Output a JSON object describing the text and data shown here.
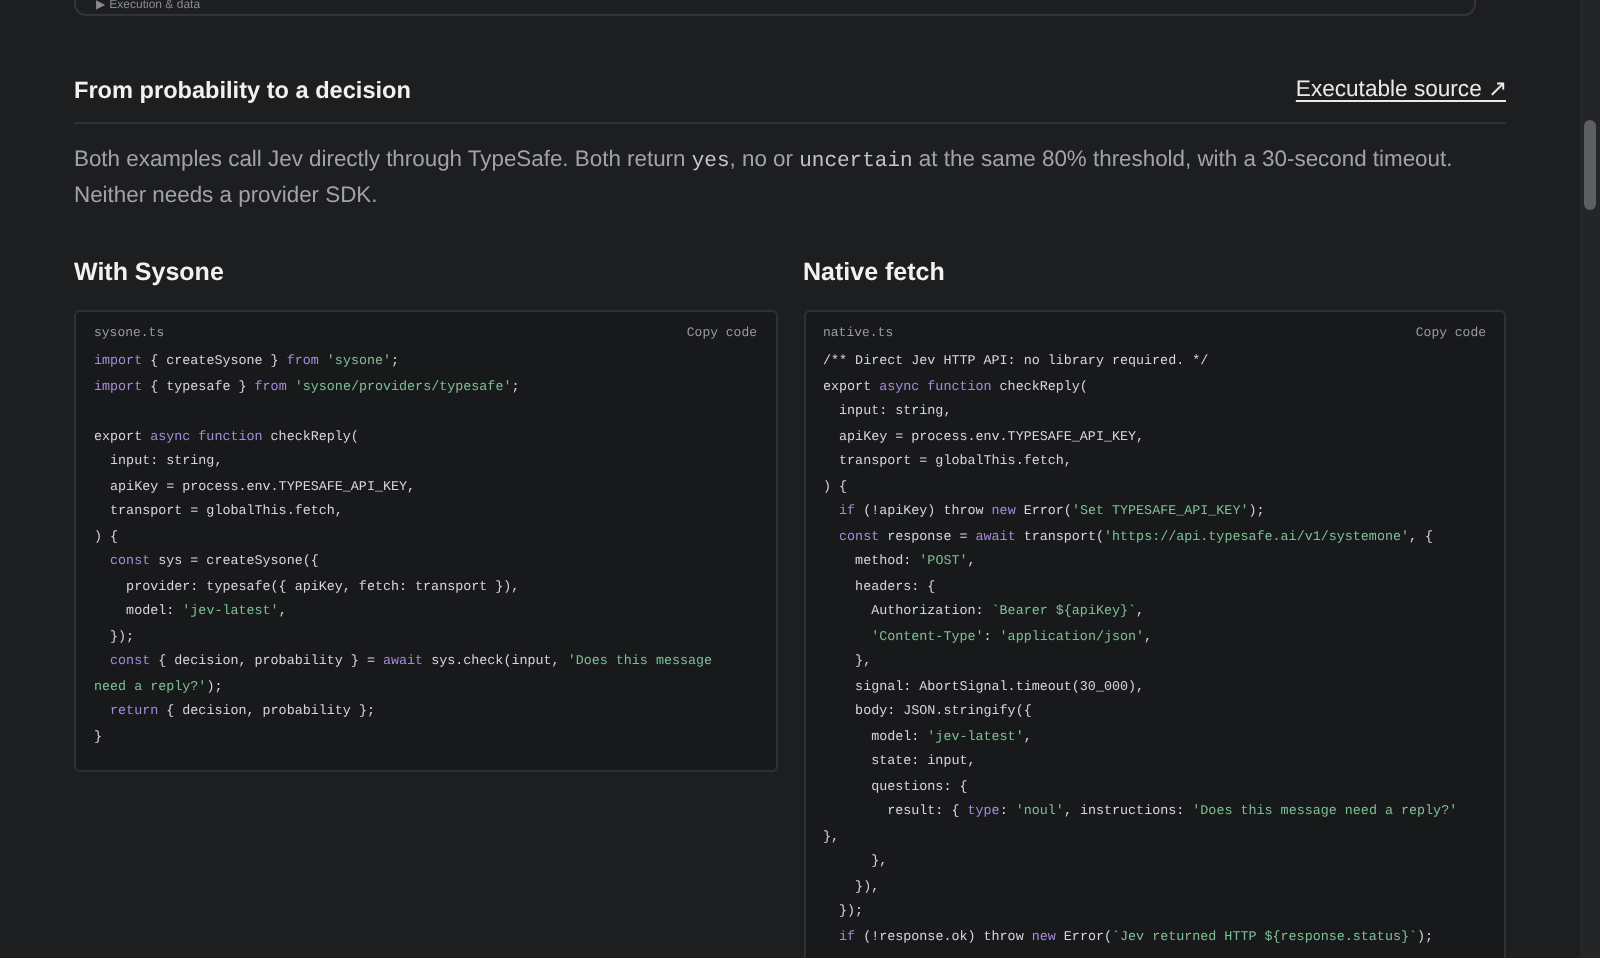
{
  "top_card": {
    "toggle": "▶ Execution & data"
  },
  "section": {
    "title": "From probability to a decision",
    "link": "Executable source ↗"
  },
  "paragraph": [
    {
      "kind": "text",
      "text": "Both examples call Jev directly through TypeSafe. Both return "
    },
    {
      "kind": "code",
      "text": "yes"
    },
    {
      "kind": "text",
      "text": ", no or "
    },
    {
      "kind": "code",
      "text": "uncertain"
    },
    {
      "kind": "text",
      "text": " at the same 80% threshold, with a 30-second timeout. Neither needs a provider SDK."
    }
  ],
  "examples": [
    {
      "heading": "With Sysone",
      "filename": "sysone.ts",
      "copy": "Copy code",
      "lines": [
        {
          "kind": "code",
          "tokens": [
            {
              "kind": "keyword",
              "text": "import"
            },
            {
              "kind": "plain",
              "text": " { createSysone } "
            },
            {
              "kind": "keyword",
              "text": "from "
            },
            {
              "kind": "string",
              "text": "'sysone'"
            },
            {
              "kind": "plain",
              "text": ";"
            }
          ]
        },
        {
          "kind": "code",
          "tokens": [
            {
              "kind": "keyword",
              "text": "import"
            },
            {
              "kind": "plain",
              "text": " { typesafe } "
            },
            {
              "kind": "keyword",
              "text": "from "
            },
            {
              "kind": "string",
              "text": "'sysone/providers/typesafe'"
            },
            {
              "kind": "plain",
              "text": ";"
            }
          ]
        },
        {
          "kind": "blank"
        },
        {
          "kind": "code",
          "tokens": [
            {
              "kind": "plain",
              "text": "export "
            },
            {
              "kind": "keyword",
              "text": "async function"
            },
            {
              "kind": "plain",
              "text": " checkReply("
            }
          ]
        },
        {
          "kind": "code",
          "tokens": [
            {
              "kind": "plain",
              "text": "  input: string,"
            }
          ]
        },
        {
          "kind": "code",
          "tokens": [
            {
              "kind": "plain",
              "text": "  apiKey = process.env.TYPESAFE_API_KEY,"
            }
          ]
        },
        {
          "kind": "code",
          "tokens": [
            {
              "kind": "plain",
              "text": "  transport = globalThis.fetch,"
            }
          ]
        },
        {
          "kind": "code",
          "tokens": [
            {
              "kind": "plain",
              "text": ") {"
            }
          ]
        },
        {
          "kind": "code",
          "tokens": [
            {
              "kind": "keyword",
              "text": "  const"
            },
            {
              "kind": "plain",
              "text": " sys = createSysone({"
            }
          ]
        },
        {
          "kind": "code",
          "tokens": [
            {
              "kind": "plain",
              "text": "    provider: typesafe({ apiKey, fetch: transport }),"
            }
          ]
        },
        {
          "kind": "code",
          "tokens": [
            {
              "kind": "plain",
              "text": "    model: "
            },
            {
              "kind": "string",
              "text": "'jev-latest'"
            },
            {
              "kind": "plain",
              "text": ","
            }
          ]
        },
        {
          "kind": "code",
          "tokens": [
            {
              "kind": "plain",
              "text": "  });"
            }
          ]
        },
        {
          "kind": "code",
          "tokens": [
            {
              "kind": "keyword",
              "text": "  const"
            },
            {
              "kind": "plain",
              "text": " { decision, probability } = "
            },
            {
              "kind": "keyword",
              "text": "await"
            },
            {
              "kind": "plain",
              "text": " sys.check(input, "
            },
            {
              "kind": "string",
              "text": "'Does this message"
            }
          ]
        },
        {
          "kind": "code",
          "tokens": [
            {
              "kind": "string",
              "text": "need a reply?'"
            },
            {
              "kind": "plain",
              "text": ");"
            }
          ]
        },
        {
          "kind": "code",
          "tokens": [
            {
              "kind": "keyword",
              "text": "  return"
            },
            {
              "kind": "plain",
              "text": " { decision, probability };"
            }
          ]
        },
        {
          "kind": "code",
          "tokens": [
            {
              "kind": "plain",
              "text": "}"
            }
          ]
        }
      ]
    },
    {
      "heading": "Native fetch",
      "filename": "native.ts",
      "copy": "Copy code",
      "lines": [
        {
          "kind": "code",
          "tokens": [
            {
              "kind": "plain",
              "text": "/** Direct Jev HTTP API: no library required. */"
            }
          ]
        },
        {
          "kind": "code",
          "tokens": [
            {
              "kind": "plain",
              "text": "export "
            },
            {
              "kind": "keyword",
              "text": "async function"
            },
            {
              "kind": "plain",
              "text": " checkReply("
            }
          ]
        },
        {
          "kind": "code",
          "tokens": [
            {
              "kind": "plain",
              "text": "  input: string,"
            }
          ]
        },
        {
          "kind": "code",
          "tokens": [
            {
              "kind": "plain",
              "text": "  apiKey = process.env.TYPESAFE_API_KEY,"
            }
          ]
        },
        {
          "kind": "code",
          "tokens": [
            {
              "kind": "plain",
              "text": "  transport = globalThis.fetch,"
            }
          ]
        },
        {
          "kind": "code",
          "tokens": [
            {
              "kind": "plain",
              "text": ") {"
            }
          ]
        },
        {
          "kind": "code",
          "tokens": [
            {
              "kind": "keyword",
              "text": "  if"
            },
            {
              "kind": "plain",
              "text": " (!apiKey) throw "
            },
            {
              "kind": "keyword",
              "text": "new"
            },
            {
              "kind": "plain",
              "text": " Error("
            },
            {
              "kind": "string",
              "text": "'Set TYPESAFE_API_KEY'"
            },
            {
              "kind": "plain",
              "text": ");"
            }
          ]
        },
        {
          "kind": "code",
          "tokens": [
            {
              "kind": "keyword",
              "text": "  const"
            },
            {
              "kind": "plain",
              "text": " response = "
            },
            {
              "kind": "keyword",
              "text": "await"
            },
            {
              "kind": "plain",
              "text": " transport("
            },
            {
              "kind": "string",
              "text": "'https://api.typesafe.ai/v1/systemone'"
            },
            {
              "kind": "plain",
              "text": ", {"
            }
          ]
        },
        {
          "kind": "code",
          "tokens": [
            {
              "kind": "plain",
              "text": "    method: "
            },
            {
              "kind": "string",
              "text": "'POST'"
            },
            {
              "kind": "plain",
              "text": ","
            }
          ]
        },
        {
          "kind": "code",
          "tokens": [
            {
              "kind": "plain",
              "text": "    headers: {"
            }
          ]
        },
        {
          "kind": "code",
          "tokens": [
            {
              "kind": "plain",
              "text": "      Authorization: "
            },
            {
              "kind": "string",
              "text": "`Bearer ${apiKey}`"
            },
            {
              "kind": "plain",
              "text": ","
            }
          ]
        },
        {
          "kind": "code",
          "tokens": [
            {
              "kind": "string",
              "text": "      'Content-Type'"
            },
            {
              "kind": "plain",
              "text": ": "
            },
            {
              "kind": "string",
              "text": "'application/json'"
            },
            {
              "kind": "plain",
              "text": ","
            }
          ]
        },
        {
          "kind": "code",
          "tokens": [
            {
              "kind": "plain",
              "text": "    },"
            }
          ]
        },
        {
          "kind": "code",
          "tokens": [
            {
              "kind": "plain",
              "text": "    signal: AbortSignal.timeout(30_000),"
            }
          ]
        },
        {
          "kind": "code",
          "tokens": [
            {
              "kind": "plain",
              "text": "    body: JSON.stringify({"
            }
          ]
        },
        {
          "kind": "code",
          "tokens": [
            {
              "kind": "plain",
              "text": "      model: "
            },
            {
              "kind": "string",
              "text": "'jev-latest'"
            },
            {
              "kind": "plain",
              "text": ","
            }
          ]
        },
        {
          "kind": "code",
          "tokens": [
            {
              "kind": "plain",
              "text": "      state: input,"
            }
          ]
        },
        {
          "kind": "code",
          "tokens": [
            {
              "kind": "plain",
              "text": "      questions: {"
            }
          ]
        },
        {
          "kind": "code",
          "tokens": [
            {
              "kind": "plain",
              "text": "        result: { "
            },
            {
              "kind": "keyword",
              "text": "type"
            },
            {
              "kind": "plain",
              "text": ": "
            },
            {
              "kind": "string",
              "text": "'noul'"
            },
            {
              "kind": "plain",
              "text": ", instructions: "
            },
            {
              "kind": "string",
              "text": "'Does this message need a reply?'"
            }
          ]
        },
        {
          "kind": "code",
          "tokens": [
            {
              "kind": "plain",
              "text": "},"
            }
          ]
        },
        {
          "kind": "code",
          "tokens": [
            {
              "kind": "plain",
              "text": "      },"
            }
          ]
        },
        {
          "kind": "code",
          "tokens": [
            {
              "kind": "plain",
              "text": "    }),"
            }
          ]
        },
        {
          "kind": "code",
          "tokens": [
            {
              "kind": "plain",
              "text": "  });"
            }
          ]
        },
        {
          "kind": "code",
          "tokens": [
            {
              "kind": "keyword",
              "text": "  if"
            },
            {
              "kind": "plain",
              "text": " (!response.ok) throw "
            },
            {
              "kind": "keyword",
              "text": "new"
            },
            {
              "kind": "plain",
              "text": " Error("
            },
            {
              "kind": "string",
              "text": "`Jev returned HTTP ${response.status}`"
            },
            {
              "kind": "plain",
              "text": ");"
            }
          ]
        }
      ]
    }
  ]
}
